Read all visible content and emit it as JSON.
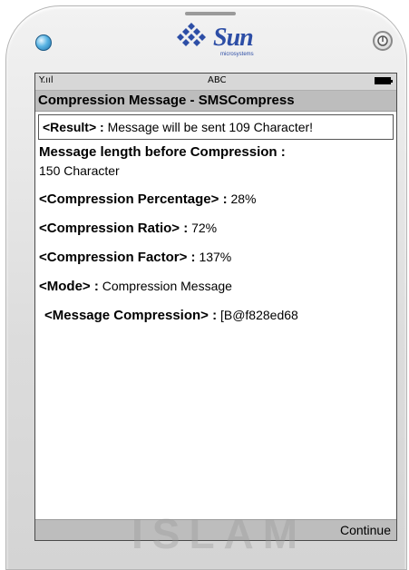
{
  "device": {
    "brand": "Sun",
    "brand_sub": "microsystems"
  },
  "status": {
    "signal": "Y.ııl",
    "input_mode": "ABC"
  },
  "screen": {
    "title": "Compression Message - SMSCompress",
    "result_label": "<Result> :",
    "result_text": "Message will be sent 109 Character!",
    "length_label": "Message length before Compression :",
    "length_value": "150 Character",
    "percentage_label": "<Compression Percentage> :",
    "percentage_value": "28%",
    "ratio_label": "<Compression Ratio> :",
    "ratio_value": "72%",
    "factor_label": "<Compression Factor> :",
    "factor_value": "137%",
    "mode_label": "<Mode> :",
    "mode_value": "Compression Message",
    "message_label": "<Message Compression> :",
    "message_value": "[B@f828ed68"
  },
  "softkeys": {
    "right": "Continue"
  },
  "watermark": "ISLAM",
  "colors": {
    "brand_blue": "#2d4ea6",
    "titlebar": "#bdbdbd",
    "led": "#3d9ad6"
  }
}
